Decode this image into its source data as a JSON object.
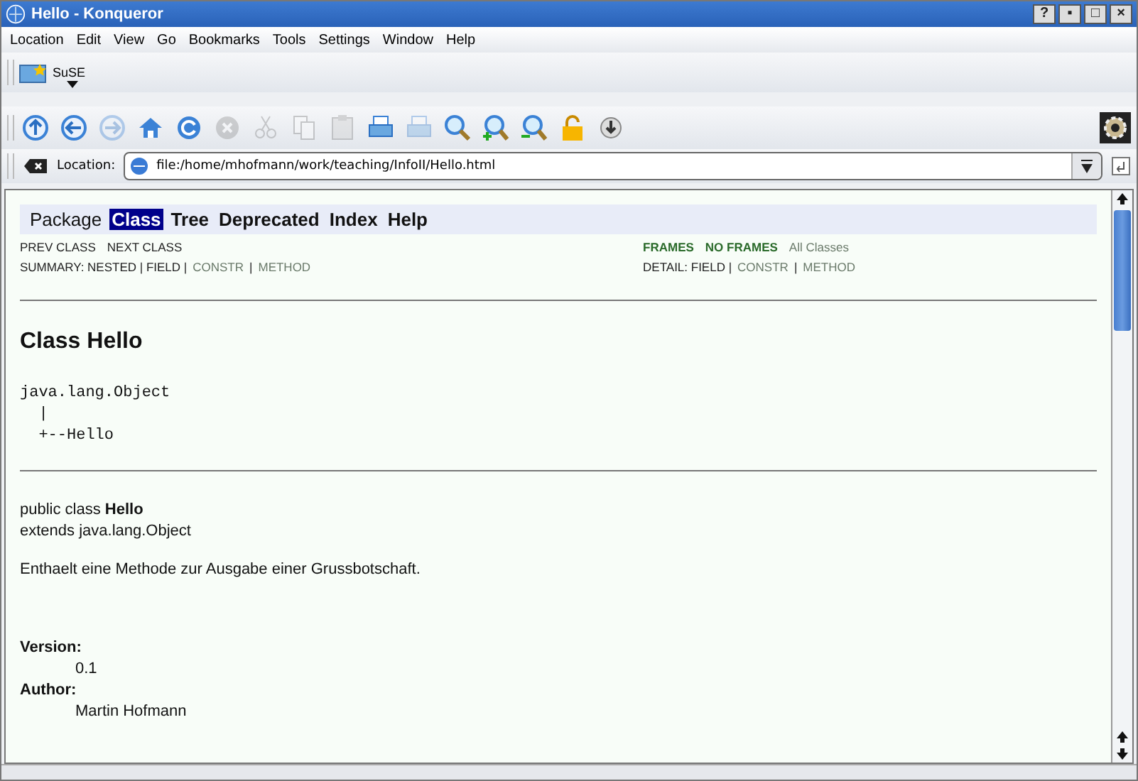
{
  "window": {
    "title": "Hello - Konqueror",
    "buttons": [
      "?",
      "▪",
      "□",
      "×"
    ]
  },
  "menu": [
    "Location",
    "Edit",
    "View",
    "Go",
    "Bookmarks",
    "Tools",
    "Settings",
    "Window",
    "Help"
  ],
  "bookmarks": [
    {
      "label": "SuSE"
    }
  ],
  "toolbar": [
    {
      "kind": "up",
      "disabled": false
    },
    {
      "kind": "back",
      "disabled": false
    },
    {
      "kind": "forward",
      "disabled": true
    },
    {
      "kind": "home",
      "disabled": false
    },
    {
      "kind": "reload",
      "disabled": false
    },
    {
      "kind": "stop",
      "disabled": true
    },
    {
      "kind": "cut",
      "disabled": true
    },
    {
      "kind": "copy",
      "disabled": true
    },
    {
      "kind": "paste",
      "disabled": true
    },
    {
      "kind": "print",
      "disabled": false
    },
    {
      "kind": "print",
      "disabled": true
    },
    {
      "kind": "find",
      "disabled": false
    },
    {
      "kind": "zoomin",
      "disabled": false
    },
    {
      "kind": "zoomout",
      "disabled": false
    },
    {
      "kind": "lock",
      "disabled": false
    },
    {
      "kind": "download",
      "disabled": false
    }
  ],
  "location": {
    "label": "Location:",
    "value": "file:/home/mhofmann/work/teaching/InfoII/Hello.html"
  },
  "page": {
    "navbar": [
      {
        "label": "Package",
        "selected": false
      },
      {
        "label": "Class",
        "selected": true
      },
      {
        "label": "Tree",
        "selected": false
      },
      {
        "label": "Deprecated",
        "selected": false
      },
      {
        "label": "Index",
        "selected": false
      },
      {
        "label": "Help",
        "selected": false
      }
    ],
    "subnav_left": [
      {
        "label": "PREV CLASS",
        "kind": "plain"
      },
      {
        "label": "NEXT CLASS",
        "kind": "plain"
      }
    ],
    "subnav_right": [
      {
        "label": "FRAMES",
        "kind": "frame"
      },
      {
        "label": "NO FRAMES",
        "kind": "frame"
      },
      {
        "label": "All Classes",
        "kind": "link"
      }
    ],
    "summary": [
      {
        "label": "SUMMARY: NESTED | FIELD |",
        "kind": "plain"
      },
      {
        "label": "CONSTR",
        "kind": "link"
      },
      {
        "label": "|",
        "kind": "plain"
      },
      {
        "label": "METHOD",
        "kind": "link"
      }
    ],
    "detail": [
      {
        "label": "DETAIL: FIELD |",
        "kind": "plain"
      },
      {
        "label": "CONSTR",
        "kind": "link"
      },
      {
        "label": "|",
        "kind": "plain"
      },
      {
        "label": "METHOD",
        "kind": "link"
      }
    ],
    "heading": "Class Hello",
    "hierarchy": [
      "java.lang.Object",
      "  |",
      "  +--Hello"
    ],
    "declaration": "public class **Hello**",
    "extends": "extends java.lang.Object",
    "description": "Enthaelt eine Methode zur Ausgabe einer Grussbotschaft.",
    "tags": [
      {
        "term": "Version:",
        "value": "0.1"
      },
      {
        "term": "Author:",
        "value": "Martin Hofmann"
      }
    ]
  }
}
